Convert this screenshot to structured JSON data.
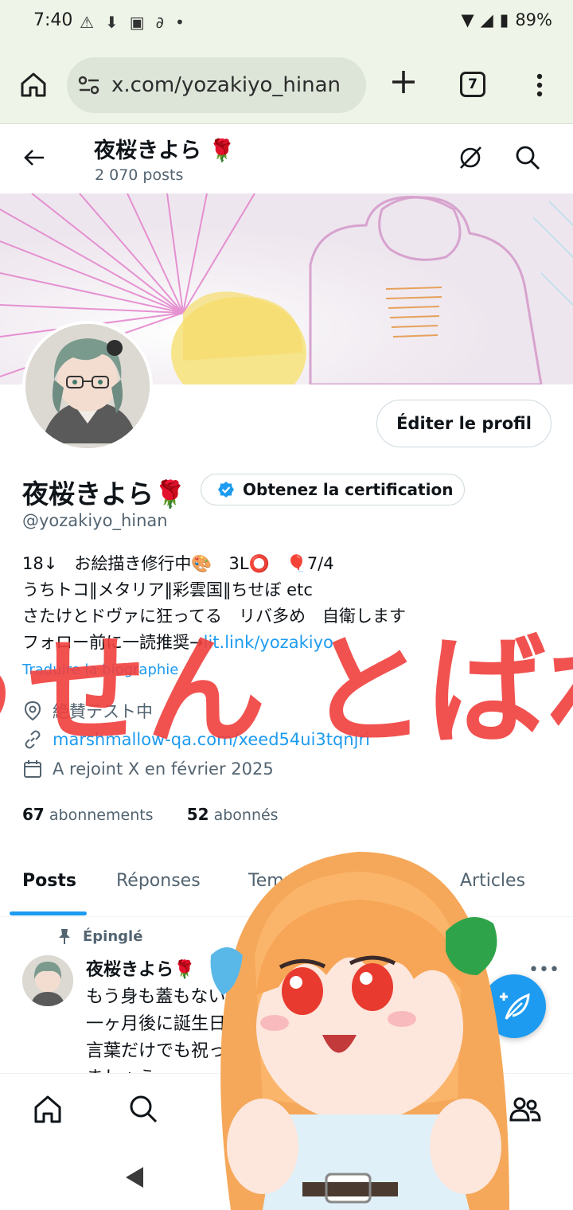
{
  "status_bar": {
    "time": "7:40",
    "battery": "89%",
    "icons": [
      "warning-icon",
      "download-icon",
      "app-icon",
      "nfc-icon",
      "dot-icon"
    ]
  },
  "browser": {
    "url": "x.com/yozakiyo_hinan",
    "tab_count": "7"
  },
  "header": {
    "name": "夜桜きよら",
    "posts_count": "2 070 posts"
  },
  "profile": {
    "display_name": "夜桜きよら",
    "verify_label": "Obtenez la certification",
    "handle": "@yozakiyo_hinan",
    "edit_label": "Éditer le profil",
    "bio_lines": [
      "18↓　お絵描き修行中🎨　3L⭕　🎈7/4",
      "うちトコ‖メタリア‖彩雲国‖ちせぼ etc",
      "さたけとドヴァに狂ってる　リバ多め　自衛します"
    ],
    "bio_line4_text": "フォロー前に一読推奨→",
    "bio_line4_link": "lit.link/yozakiyo",
    "translate": "Traduire la biographie",
    "location": "絶賛テスト中",
    "website": "marshmallow-qa.com/xeed54ui3tqnjri",
    "joined": "A rejoint X en février 2025",
    "following_count": "67",
    "following_label": "abonnements",
    "followers_count": "52",
    "followers_label": "abonnés"
  },
  "tabs": [
    {
      "label": "Posts",
      "active": true
    },
    {
      "label": "Réponses",
      "active": false
    },
    {
      "label": "Temps forts",
      "active": false
    },
    {
      "label": "Articles",
      "active": false
    }
  ],
  "pinned_post": {
    "pinned_label": "Épinglé",
    "author": "夜桜きよら",
    "lines": [
      "もう身も蓋もないですが",
      "一ヶ月後に誕生日です",
      "言葉だけでも祝ってくれたら嬉しいです！まし",
      "ましょう"
    ]
  },
  "overlay_text": "ふうせん とばねえ",
  "colors": {
    "accent": "#1d9bf0",
    "overlay_red": "#f0403e",
    "browser_bg": "#eef5e8"
  }
}
